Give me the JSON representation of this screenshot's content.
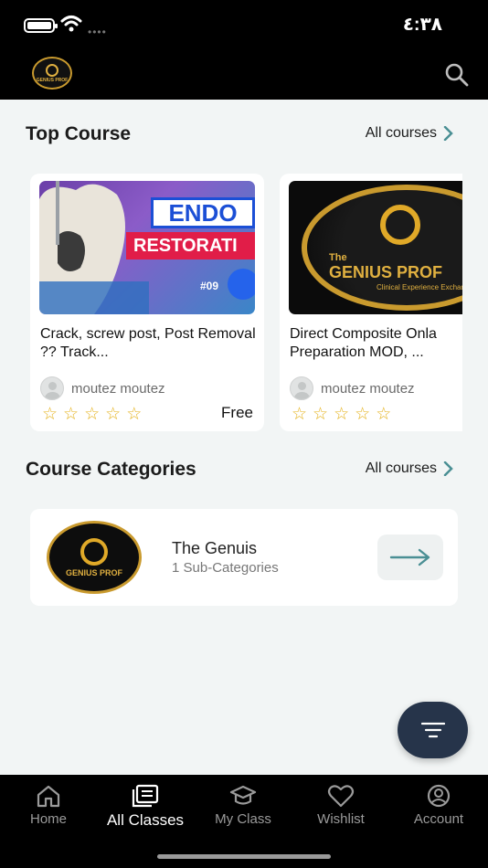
{
  "status_bar": {
    "time": "٤:٣٨"
  },
  "header": {
    "logo_text": "GENIUS PROF",
    "search_icon": "search-icon"
  },
  "top_course": {
    "title": "Top Course",
    "see_all": "All courses",
    "courses": [
      {
        "thumb_text_1": "ENDO",
        "thumb_text_2": "RESTORATI",
        "thumb_badge": "#09",
        "title": "Crack, screw post, Post Removal ?? Track...",
        "author": "moutez moutez",
        "rating": 0,
        "price": "Free"
      },
      {
        "thumb_text_1": "The",
        "thumb_text_2": "GENIUS PROF",
        "thumb_badge": "Clinical Experience Exchange",
        "title": "Direct Composite Onla Preparation MOD, ...",
        "author": "moutez moutez",
        "rating": 0,
        "price": ""
      }
    ]
  },
  "categories": {
    "title": "Course Categories",
    "see_all": "All courses",
    "items": [
      {
        "logo_text": "GENIUS PROF",
        "name": "The Genuis",
        "sub": "1 Sub-Categories"
      }
    ]
  },
  "bottom_nav": {
    "items": [
      {
        "label": "Home",
        "icon": "home-icon"
      },
      {
        "label": "All Classes",
        "icon": "classes-icon"
      },
      {
        "label": "My Class",
        "icon": "graduation-cap-icon"
      },
      {
        "label": "Wishlist",
        "icon": "heart-icon"
      },
      {
        "label": "Account",
        "icon": "account-icon"
      }
    ],
    "active": "All Classes"
  },
  "colors": {
    "background": "#f2f5f5",
    "fab": "#26344a",
    "star": "#e5b21b",
    "arrow_teal": "#4a8f94",
    "logo_gold": "#c99a2e"
  }
}
